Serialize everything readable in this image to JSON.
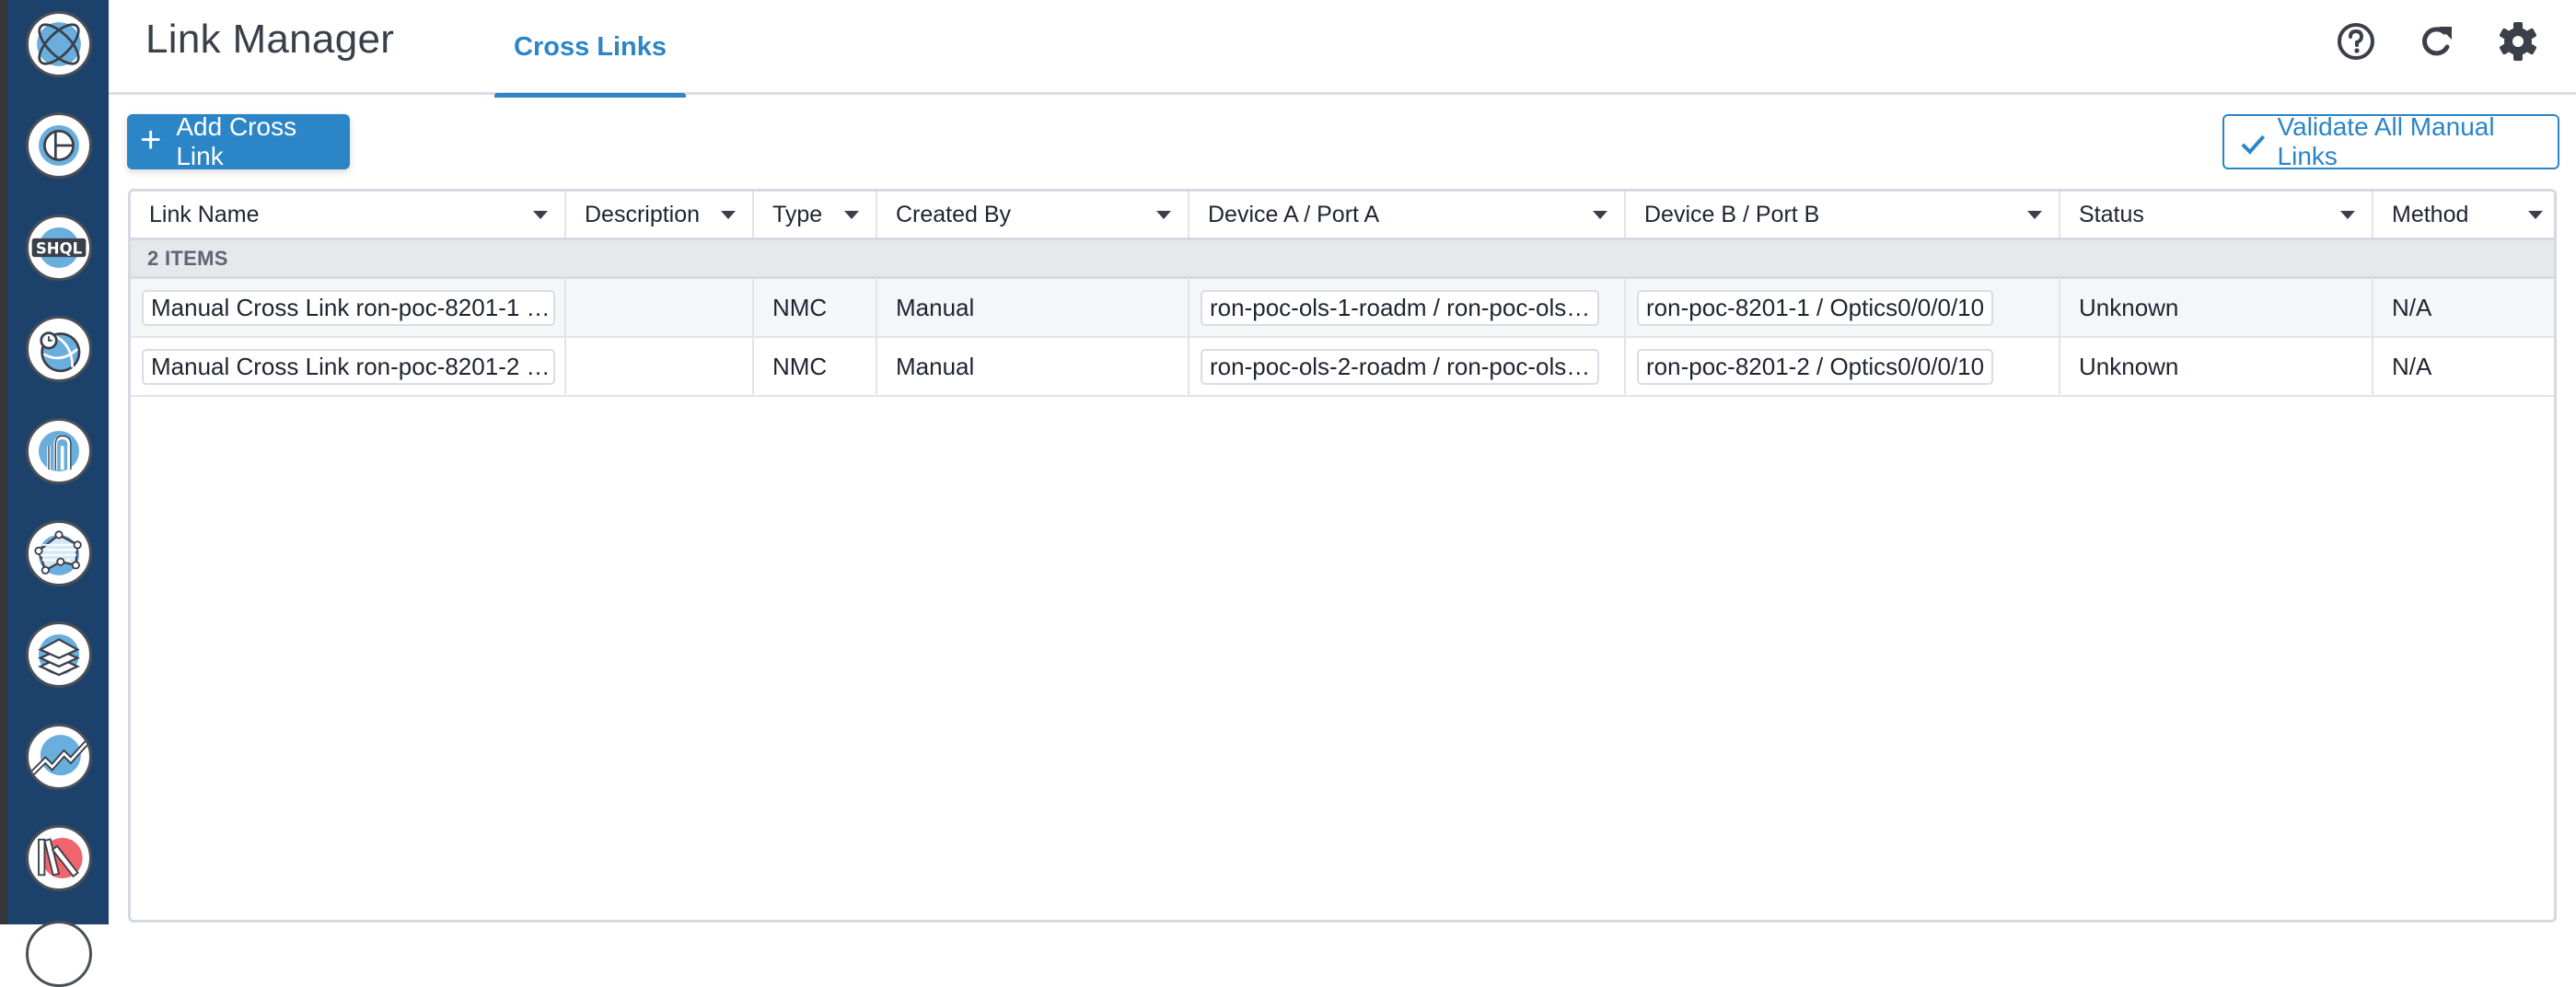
{
  "app": {
    "title": "Link Manager"
  },
  "tabs": [
    {
      "label": "Cross Links",
      "active": true
    }
  ],
  "header_icons": [
    "help-icon",
    "refresh-icon",
    "settings-icon"
  ],
  "sidebar": {
    "items": [
      {
        "name": "home-logo-icon"
      },
      {
        "name": "dashboard-icon"
      },
      {
        "name": "shql-icon",
        "label": "SHQL"
      },
      {
        "name": "history-globe-icon"
      },
      {
        "name": "paths-icon"
      },
      {
        "name": "topology-icon"
      },
      {
        "name": "layers-icon"
      },
      {
        "name": "analytics-trend-icon"
      },
      {
        "name": "library-books-icon"
      }
    ]
  },
  "toolbar": {
    "add_label": "Add Cross Link",
    "validate_label": "Validate All Manual Links"
  },
  "table": {
    "columns": [
      "Link Name",
      "Description",
      "Type",
      "Created By",
      "Device A / Port A",
      "Device B / Port B",
      "Status",
      "Method"
    ],
    "group_label": "2 ITEMS",
    "rows": [
      {
        "link_name": "Manual Cross Link ron-poc-8201-1 …",
        "description": "",
        "type": "NMC",
        "created_by": "Manual",
        "device_a": "ron-poc-ols-1-roadm / ron-poc-ols…",
        "device_b": "ron-poc-8201-1 / Optics0/0/0/10",
        "status": "Unknown",
        "method": "N/A"
      },
      {
        "link_name": "Manual Cross Link ron-poc-8201-2 …",
        "description": "",
        "type": "NMC",
        "created_by": "Manual",
        "device_a": "ron-poc-ols-2-roadm / ron-poc-ols…",
        "device_b": "ron-poc-8201-2 / Optics0/0/0/10",
        "status": "Unknown",
        "method": "N/A"
      }
    ]
  },
  "colors": {
    "accent": "#2b85c7",
    "sidebar_bg": "#1c426b",
    "icon_blue": "#6aaedd",
    "icon_red": "#f0646e",
    "text": "#1f2430"
  }
}
